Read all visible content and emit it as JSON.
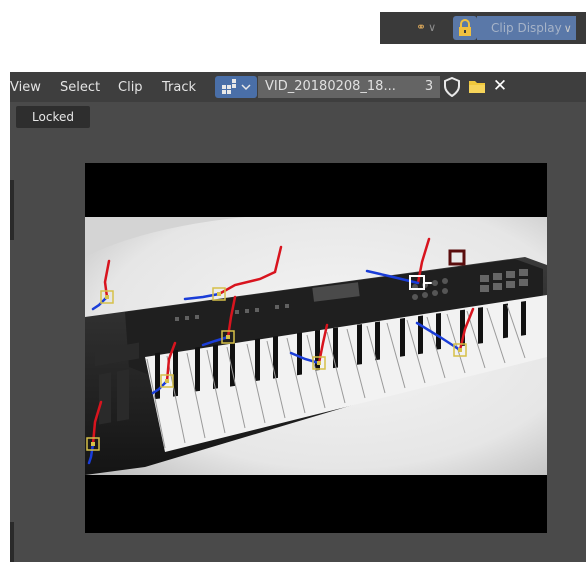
{
  "topbar": {
    "clip_display_label": "Clip Display",
    "link_glyph": "⚭",
    "dropdown_chevron": "∨",
    "lock_icon": "lock-icon"
  },
  "header": {
    "menu": [
      "View",
      "Select",
      "Clip",
      "Track"
    ],
    "clip_name": "VID_20180208_18...",
    "users_count": "3",
    "icons": [
      "editor-type-icon",
      "shield-icon",
      "folder-icon",
      "close-icon"
    ],
    "close_glyph": "✕"
  },
  "status": {
    "locked_label": "Locked"
  },
  "colors": {
    "header_bg": "#3e3e3e",
    "editor_bg": "#4a4a4a",
    "accent_blue": "#4a6fa8",
    "track_red": "#d8141e",
    "track_blue": "#1a3dd8",
    "marker_yellow": "#d6c048",
    "folder_yellow": "#f0c83c",
    "selected_white": "#ffffff",
    "search_area": "#5a0d0d"
  }
}
